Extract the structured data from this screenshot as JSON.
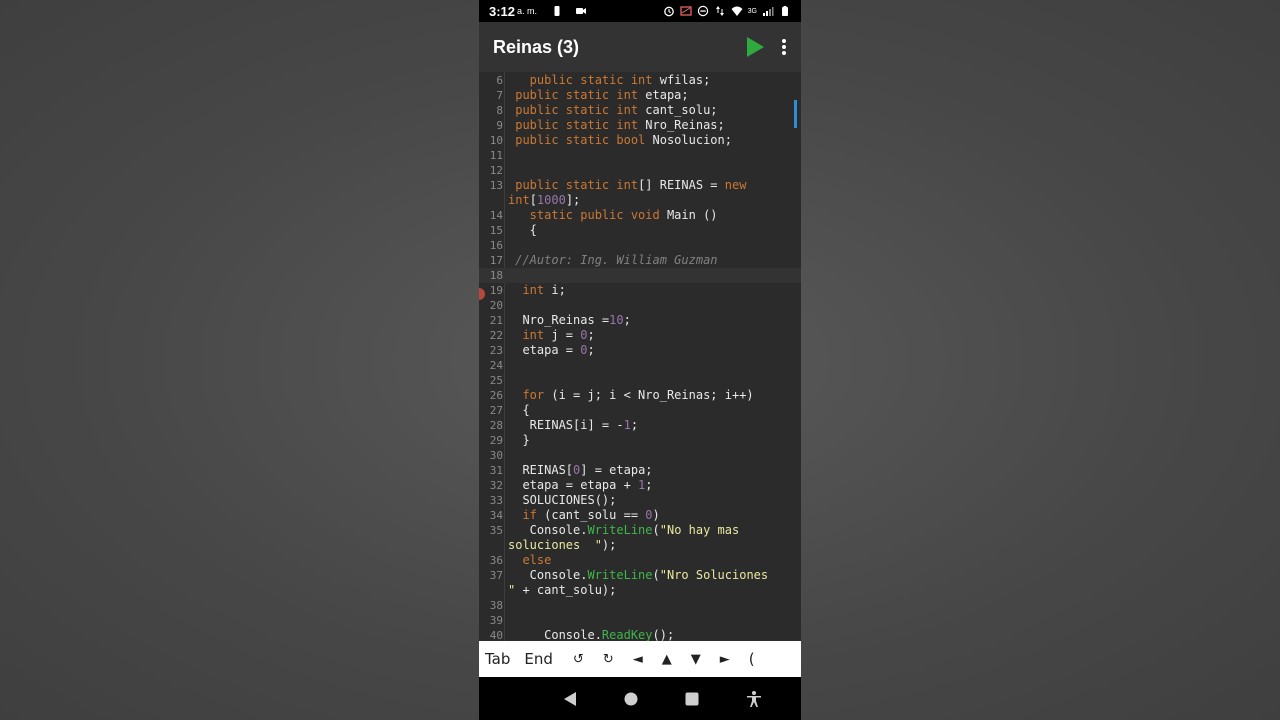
{
  "status": {
    "time": "3:12",
    "ampm": "a. m.",
    "network": "3G"
  },
  "app": {
    "title": "Reinas (3)"
  },
  "icons": {
    "run": "play-icon",
    "menu": "more-vert-icon",
    "back": "nav-back-icon",
    "home": "nav-home-icon",
    "recents": "nav-recents-icon",
    "accessibility": "accessibility-icon"
  },
  "colors": {
    "keyword": "#cc7832",
    "number": "#9876aa",
    "string": "#e8e8a0",
    "method": "#3fb64a",
    "comment": "#808080",
    "accent": "#2a8fd8"
  },
  "editor": {
    "line_numbers": [
      "6",
      "7",
      "8",
      "9",
      "10",
      "11",
      "12",
      "13",
      "14",
      "15",
      "16",
      "17",
      "18",
      "19",
      "20",
      "21",
      "22",
      "23",
      "24",
      "25",
      "26",
      "27",
      "28",
      "29",
      "30",
      "31",
      "32",
      "33",
      "34",
      "35",
      "36",
      "37",
      "38",
      "39",
      "40"
    ],
    "snippets": {
      "l6a": "   public static ",
      "l6b": "int",
      "l6c": " wfilas;",
      "l7a": " public static int",
      "l7b": " etapa;",
      "l8a": " public static int",
      "l8b": " cant_solu;",
      "l9a": " public static int",
      "l9b": " Nro_Reinas;",
      "l10a": " public static bool",
      "l10b": " Nosolucion;",
      "l13a": " public static ",
      "l13b": "int",
      "l13c": "[] REINAS = ",
      "l13d": "new",
      "l13e": "int",
      "l13f": "[",
      "l13g": "1000",
      "l13h": "];",
      "l14a": "   static public void",
      "l14b": " Main ()",
      "l15": "   {",
      "l17": " //Autor: Ing. William Guzman",
      "l19a": "  int",
      "l19b": " i;",
      "l21a": "  Nro_Reinas =",
      "l21b": "10",
      "l21c": ";",
      "l22a": "  int",
      "l22b": " j = ",
      "l22c": "0",
      "l22d": ";",
      "l23a": "  etapa = ",
      "l23b": "0",
      "l23c": ";",
      "l26a": "  for",
      "l26b": " (i = j; i < Nro_Reinas; i++)",
      "l27": "  {",
      "l28a": "   REINAS[i] = -",
      "l28b": "1",
      "l28c": ";",
      "l29": "  }",
      "l31a": "  REINAS[",
      "l31b": "0",
      "l31c": "] = etapa;",
      "l32a": "  etapa = etapa + ",
      "l32b": "1",
      "l32c": ";",
      "l33": "  SOLUCIONES();",
      "l34a": "  if",
      "l34b": " (cant_solu == ",
      "l34c": "0",
      "l34d": ")",
      "l35a": "   Console.",
      "l35b": "WriteLine",
      "l35c": "(",
      "l35d": "\"No hay mas",
      "l35e": "soluciones  \"",
      "l35f": ");",
      "l36": "  else",
      "l37a": "   Console.",
      "l37b": "WriteLine",
      "l37c": "(",
      "l37d": "\"Nro Soluciones",
      "l37e": "\"",
      "l37f": " + cant_solu);",
      "l40a": "     Console.",
      "l40b": "ReadKey",
      "l40c": "();"
    }
  },
  "keys": [
    "Tab",
    "End",
    "↺",
    "↻",
    "◄",
    "▲",
    "▼",
    "►",
    "("
  ]
}
